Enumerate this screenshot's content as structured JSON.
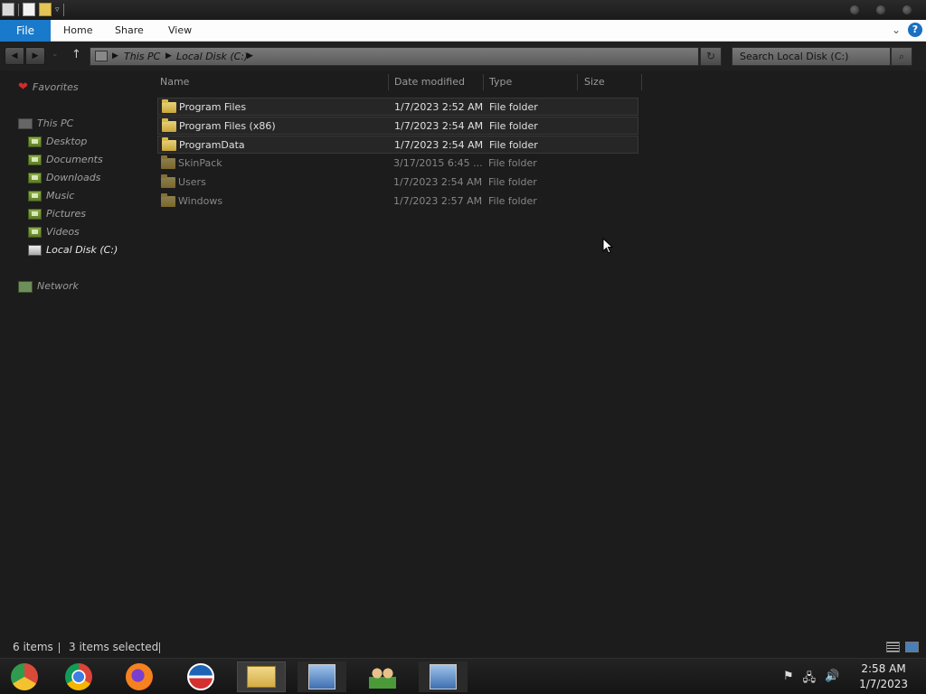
{
  "ribbon": {
    "tabs": [
      {
        "label": "File"
      },
      {
        "label": "Home"
      },
      {
        "label": "Share"
      },
      {
        "label": "View"
      }
    ]
  },
  "address": {
    "crumbs": [
      "This PC",
      "Local Disk (C:)"
    ]
  },
  "search": {
    "placeholder": "Search Local Disk (C:)"
  },
  "navpane": {
    "favorites": "Favorites",
    "this_pc": "This PC",
    "items": [
      "Desktop",
      "Documents",
      "Downloads",
      "Music",
      "Pictures",
      "Videos",
      "Local Disk (C:)"
    ],
    "network": "Network"
  },
  "columns": [
    "Name",
    "Date modified",
    "Type",
    "Size"
  ],
  "files": [
    {
      "name": "Program Files",
      "date": "1/7/2023 2:52 AM",
      "type": "File folder",
      "selected": true
    },
    {
      "name": "Program Files (x86)",
      "date": "1/7/2023 2:54 AM",
      "type": "File folder",
      "selected": true
    },
    {
      "name": "ProgramData",
      "date": "1/7/2023 2:54 AM",
      "type": "File folder",
      "selected": true
    },
    {
      "name": "SkinPack",
      "date": "3/17/2015 6:45 ...",
      "type": "File folder",
      "selected": false
    },
    {
      "name": "Users",
      "date": "1/7/2023 2:54 AM",
      "type": "File folder",
      "selected": false
    },
    {
      "name": "Windows",
      "date": "1/7/2023 2:57 AM",
      "type": "File folder",
      "selected": false
    }
  ],
  "status": {
    "item_count": "6 items",
    "selected_count": "3 items selected"
  },
  "taskbar": {
    "apps": [
      "chromium-icon",
      "chrome-icon",
      "firefox-icon",
      "obama-logo-icon",
      "file-explorer-icon",
      "network-setup-icon",
      "users-icon",
      "network-setup-icon"
    ]
  },
  "clock": {
    "time": "2:58 AM",
    "date": "1/7/2023"
  },
  "colors": {
    "accent": "#1979ca",
    "background": "#1c1c1c"
  }
}
